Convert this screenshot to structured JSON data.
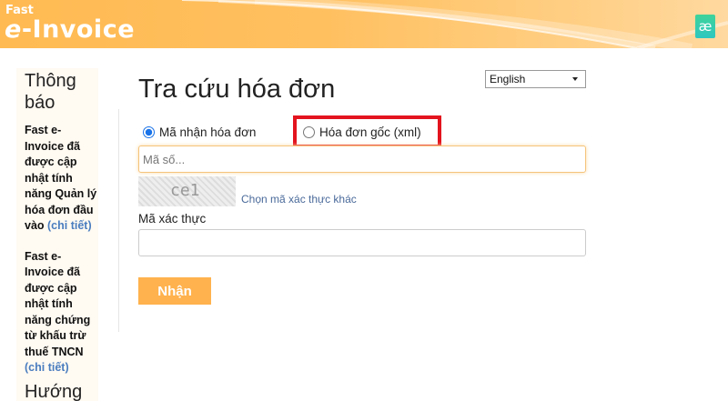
{
  "header": {
    "logo_small": "Fast",
    "logo_prefix": "e",
    "logo_main": "-Invoice",
    "app_icon": "æ"
  },
  "sidebar": {
    "title": "Thông báo",
    "items": [
      {
        "text": "Fast e-Invoice đã được cập nhật tính năng Quản lý hóa đơn đầu vào ",
        "link": "(chi tiết)"
      },
      {
        "text": "Fast e-Invoice đã được cập nhật tính năng chứng từ khấu trừ thuế TNCN ",
        "link": "(chi tiết)"
      }
    ],
    "next_heading": "Hướng"
  },
  "main": {
    "title": "Tra cứu hóa đơn",
    "language": "English",
    "radio_options": [
      {
        "label": "Mã nhận hóa đơn",
        "selected": true
      },
      {
        "label": "Hóa đơn gốc (xml)",
        "selected": false
      }
    ],
    "code_placeholder": "Mã số...",
    "captcha_text": "ce1",
    "captcha_refresh": "Chọn mã xác thực khác",
    "verify_label": "Mã xác thực",
    "verify_value": "",
    "submit": "Nhận"
  },
  "colors": {
    "accent": "#ffb24d",
    "highlight": "#e3141e",
    "radio": "#1a73e8",
    "link": "#4a7dbf"
  }
}
